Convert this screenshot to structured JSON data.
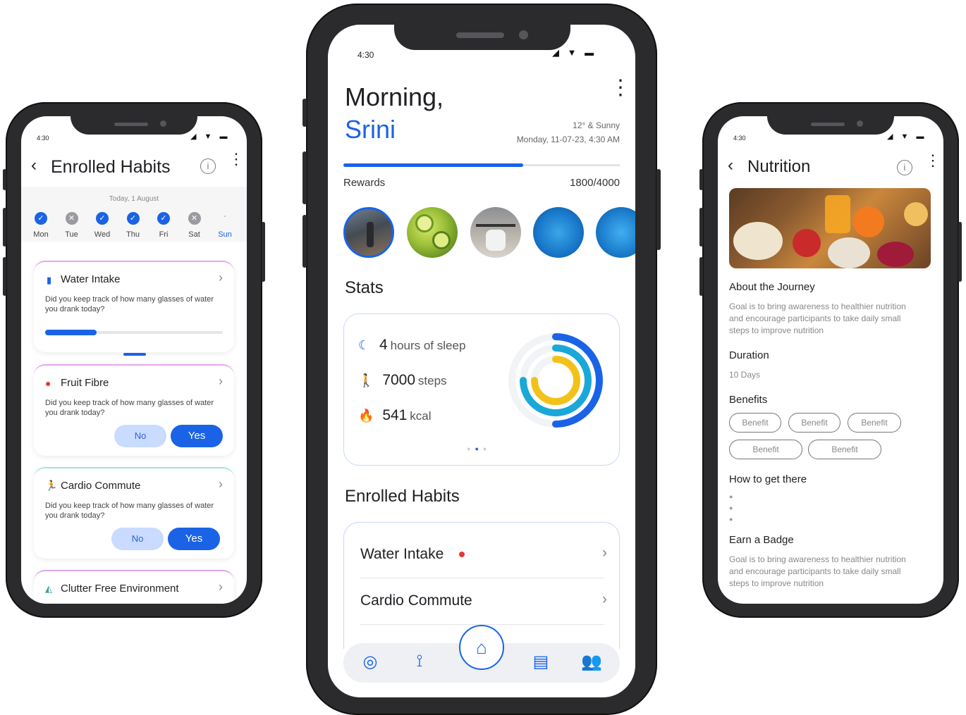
{
  "left": {
    "status_time": "4:30",
    "title": "Enrolled Habits",
    "date_label": "Today, 1 August",
    "days": [
      {
        "label": "Mon",
        "state": "done"
      },
      {
        "label": "Tue",
        "state": "missed"
      },
      {
        "label": "Wed",
        "state": "done"
      },
      {
        "label": "Thu",
        "state": "done"
      },
      {
        "label": "Fri",
        "state": "done"
      },
      {
        "label": "Sat",
        "state": "missed"
      },
      {
        "label": "Sun",
        "state": "today"
      }
    ],
    "sun_dash": "-",
    "cards": [
      {
        "title": "Water Intake",
        "desc": "Did you keep track of how many glasses of water you drank today?",
        "progress": 0.29
      },
      {
        "title": "Fruit Fibre",
        "desc": "Did you keep track of how many glasses of water you drank today?",
        "no": "No",
        "yes": "Yes"
      },
      {
        "title": "Cardio Commute",
        "desc": "Did you keep track of how many glasses of water you drank today?",
        "no": "No",
        "yes": "Yes"
      },
      {
        "title": "Clutter Free Environment"
      }
    ]
  },
  "center": {
    "status_time": "4:30",
    "greeting": "Morning,",
    "name": "Srini",
    "weather": "12° & Sunny",
    "datetime": "Monday, 11-07-23, 4:30 AM",
    "rewards_label": "Rewards",
    "rewards_value": "1800/4000",
    "rewards_progress": 0.65,
    "stats_heading": "Stats",
    "stats": [
      {
        "num": "4",
        "unit": "hours of sleep"
      },
      {
        "num": "7000",
        "unit": "steps"
      },
      {
        "num": "541",
        "unit": "kcal"
      }
    ],
    "enrolled_heading": "Enrolled Habits",
    "habits": [
      "Water Intake",
      "Cardio Commute"
    ],
    "colors": {
      "accent": "#1a63e6",
      "alert": "#e53935"
    }
  },
  "right": {
    "status_time": "4:30",
    "title": "Nutrition",
    "about_heading": "About the Journey",
    "about_text": "Goal is to bring awareness to healthier nutrition and encourage participants to take daily small steps to improve nutrition",
    "duration_heading": "Duration",
    "duration_value": "10 Days",
    "benefits_heading": "Benefits",
    "benefits": [
      "Benefit",
      "Benefit",
      "Benefit",
      "Benefit",
      "Benefit"
    ],
    "how_heading": "How to get there",
    "badge_heading": "Earn a Badge",
    "badge_text": "Goal is to bring awareness to healthier nutrition and encourage participants to take daily small steps to improve nutrition"
  }
}
